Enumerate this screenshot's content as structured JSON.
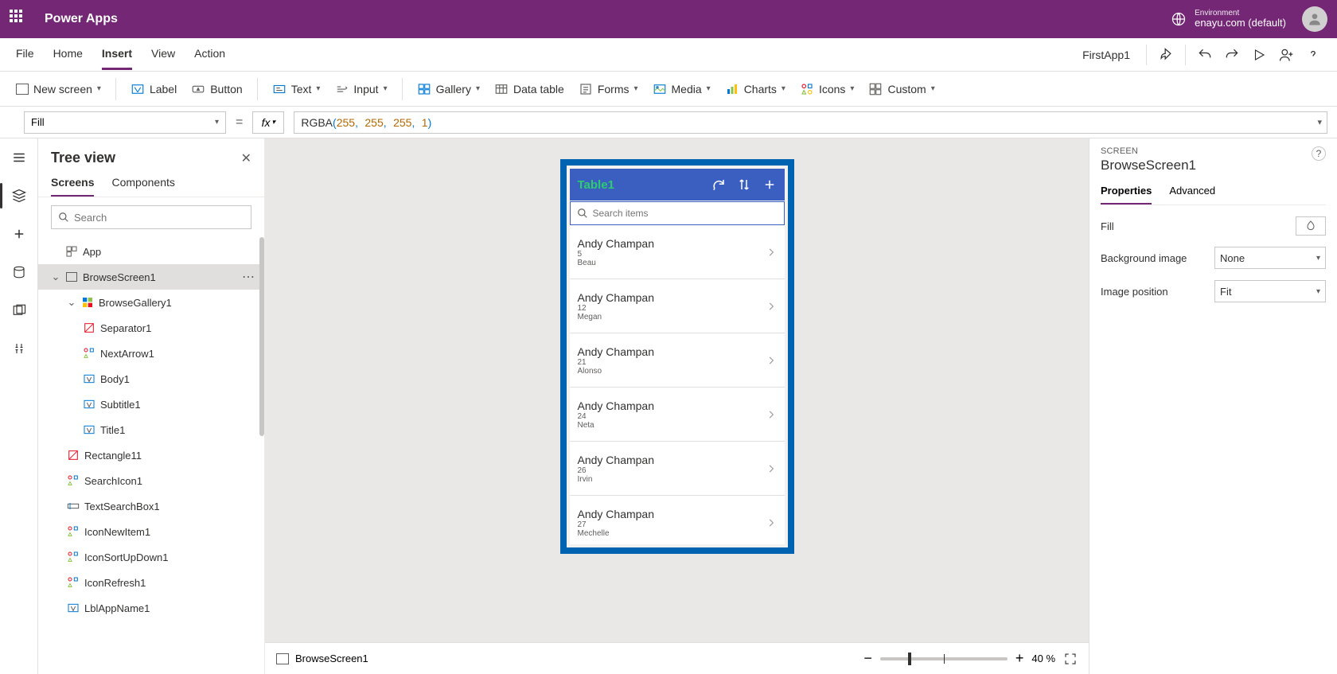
{
  "header": {
    "app_title": "Power Apps",
    "env_label": "Environment",
    "env_value": "enayu.com (default)"
  },
  "menu": {
    "items": [
      "File",
      "Home",
      "Insert",
      "View",
      "Action"
    ],
    "active": "Insert",
    "app_name": "FirstApp1"
  },
  "toolbar": {
    "new_screen": "New screen",
    "label": "Label",
    "button": "Button",
    "text": "Text",
    "input": "Input",
    "gallery": "Gallery",
    "data_table": "Data table",
    "forms": "Forms",
    "media": "Media",
    "charts": "Charts",
    "icons": "Icons",
    "custom": "Custom"
  },
  "formula": {
    "property": "Fill",
    "fn": "RGBA",
    "args": [
      "255",
      "255",
      "255",
      "1"
    ]
  },
  "tree": {
    "title": "Tree view",
    "tabs": [
      "Screens",
      "Components"
    ],
    "search_placeholder": "Search",
    "nodes": {
      "app": "App",
      "browsescreen": "BrowseScreen1",
      "gallery": "BrowseGallery1",
      "separator": "Separator1",
      "nextarrow": "NextArrow1",
      "body": "Body1",
      "subtitle": "Subtitle1",
      "title": "Title1",
      "rectangle": "Rectangle11",
      "searchicon": "SearchIcon1",
      "textsearch": "TextSearchBox1",
      "iconnew": "IconNewItem1",
      "iconsort": "IconSortUpDown1",
      "iconrefresh": "IconRefresh1",
      "lblappname": "LblAppName1"
    }
  },
  "preview": {
    "title": "Table1",
    "search_placeholder": "Search items",
    "items": [
      {
        "title": "Andy Champan",
        "sub": "5",
        "body": "Beau"
      },
      {
        "title": "Andy Champan",
        "sub": "12",
        "body": "Megan"
      },
      {
        "title": "Andy Champan",
        "sub": "21",
        "body": "Alonso"
      },
      {
        "title": "Andy Champan",
        "sub": "24",
        "body": "Neta"
      },
      {
        "title": "Andy Champan",
        "sub": "26",
        "body": "Irvin"
      },
      {
        "title": "Andy Champan",
        "sub": "27",
        "body": "Mechelle"
      }
    ]
  },
  "footer": {
    "screen": "BrowseScreen1",
    "zoom": "40",
    "zoom_suffix": "%"
  },
  "props": {
    "category": "SCREEN",
    "name": "BrowseScreen1",
    "tabs": [
      "Properties",
      "Advanced"
    ],
    "rows": {
      "fill": "Fill",
      "bgimage": "Background image",
      "bgimage_val": "None",
      "imgpos": "Image position",
      "imgpos_val": "Fit"
    }
  }
}
